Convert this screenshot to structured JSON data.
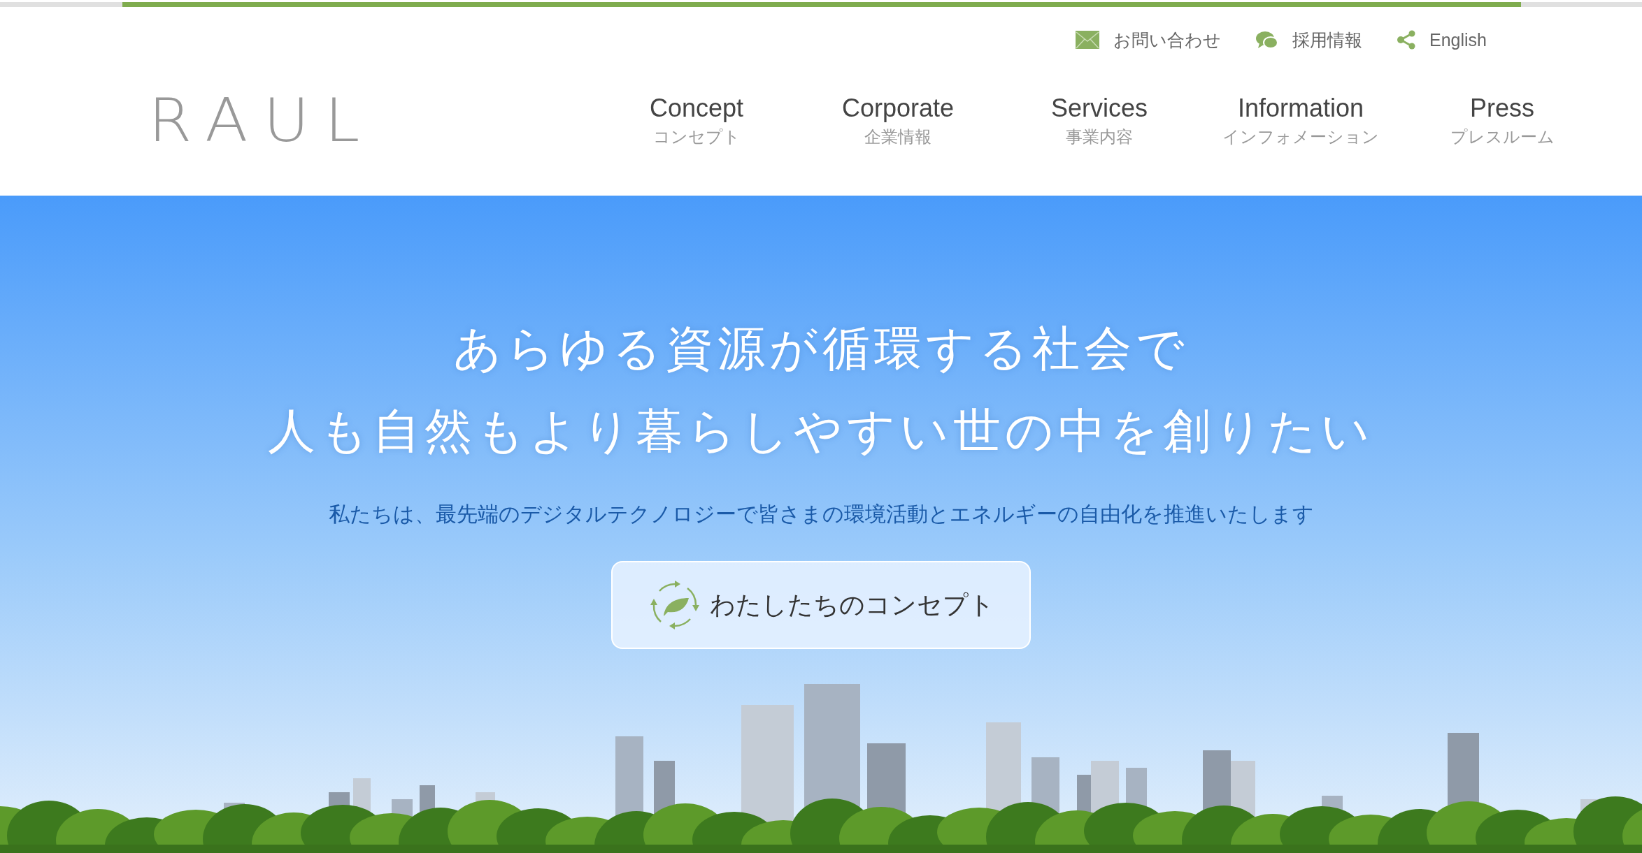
{
  "logo": "RAUL",
  "utility_links": [
    {
      "kind": "mail",
      "label": "お問い合わせ"
    },
    {
      "kind": "chat",
      "label": "採用情報"
    },
    {
      "kind": "share",
      "label": "English"
    }
  ],
  "nav": [
    {
      "title": "Concept",
      "subtitle": "コンセプト"
    },
    {
      "title": "Corporate",
      "subtitle": "企業情報"
    },
    {
      "title": "Services",
      "subtitle": "事業内容"
    },
    {
      "title": "Information",
      "subtitle": "インフォメーション"
    },
    {
      "title": "Press",
      "subtitle": "プレスルーム"
    }
  ],
  "hero": {
    "headline": [
      "あらゆる資源が循環する社会で",
      "人も自然もより暮らしやすい世の中を創りたい"
    ],
    "lead": "私たちは、最先端のデジタルテクノロジーで皆さまの環境活動とエネルギーの自由化を推進いたします",
    "button": "わたしたちのコンセプト"
  }
}
